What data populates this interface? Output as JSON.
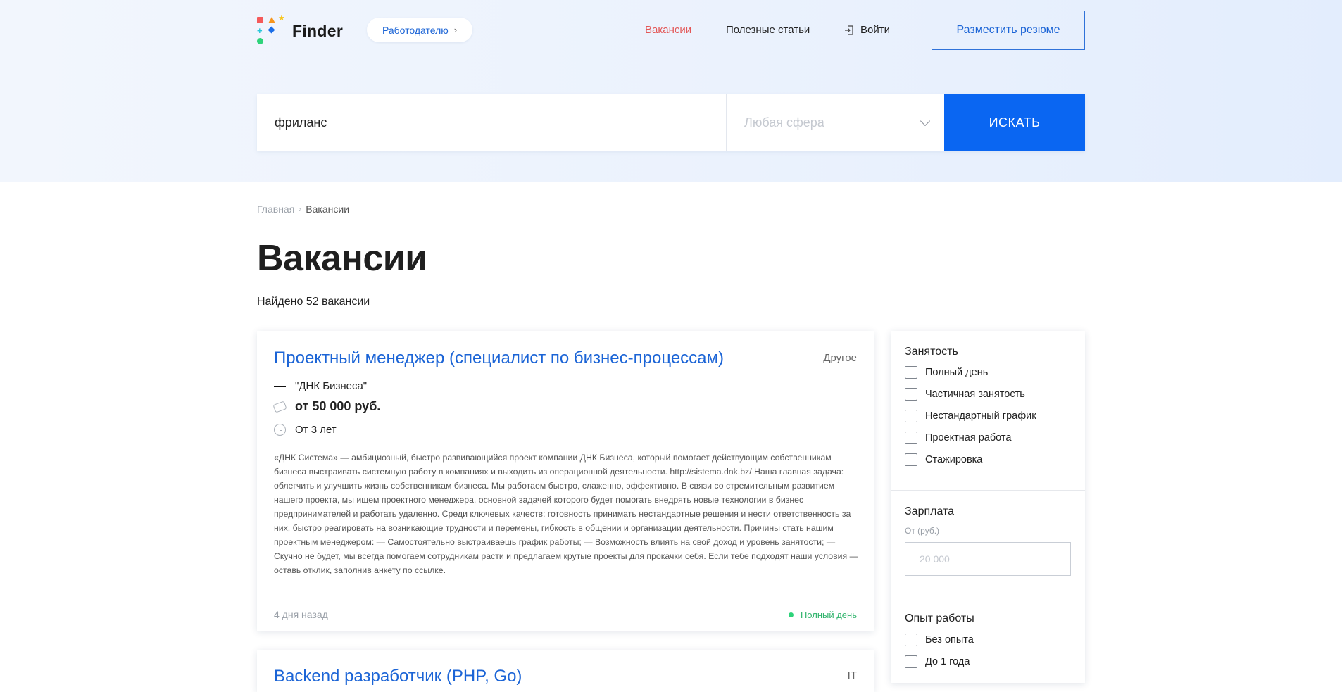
{
  "header": {
    "logo_text": "Finder",
    "employer_label": "Работодателю",
    "nav": {
      "vacancies": "Вакансии",
      "articles": "Полезные статьи",
      "login": "Войти"
    },
    "resume_button": "Разместить резюме"
  },
  "search": {
    "query_value": "фриланс",
    "sphere_placeholder": "Любая сфера",
    "button": "ИСКАТЬ"
  },
  "breadcrumb": {
    "home": "Главная",
    "current": "Вакансии"
  },
  "page": {
    "title": "Вакансии",
    "found": "Найдено 52 вакансии"
  },
  "vacancies": [
    {
      "title": "Проектный менеджер (специалист по бизнес-процессам)",
      "category": "Другое",
      "company": "\"ДНК Бизнеса\"",
      "salary": "от 50 000 руб.",
      "experience": "От 3 лет",
      "description": "«ДНК Система» — амбициозный, быстро развивающийся проект компании ДНК Бизнеса, который помогает действующим собственникам бизнеса выстраивать системную работу в компаниях и выходить из операционной деятельности. http://sistema.dnk.bz/ Наша главная задача: облегчить и улучшить жизнь собственникам бизнеса. Мы работаем быстро, слаженно, эффективно. В связи со стремительным развитием нашего проекта, мы ищем проектного менеджера, основной задачей которого будет помогать внедрять новые технологии в бизнес предпринимателей и работать удаленно. Среди ключевых качеств: готовность принимать нестандартные решения и нести ответственность за них, быстро реагировать на возникающие трудности и перемены, гибкость в общении и организации деятельности. Причины стать нашим проектным менеджером: — Самостоятельно выстраиваешь график работы; — Возможность влиять на свой доход и уровень занятости; — Скучно не будет, мы всегда помогаем сотрудникам расти и предлагаем крутые проекты для прокачки себя. Если тебе подходят наши условия — оставь отклик, заполнив анкету по ссылке.",
      "posted": "4 дня назад",
      "employment": "Полный день"
    },
    {
      "title": "Backend разработчик (PHP, Go)",
      "category": "IT"
    }
  ],
  "filters": {
    "employment": {
      "title": "Занятость",
      "options": [
        "Полный день",
        "Частичная занятость",
        "Нестандартный график",
        "Проектная работа",
        "Стажировка"
      ]
    },
    "salary": {
      "title": "Зарплата",
      "from_label": "От (руб.)",
      "placeholder": "20 000"
    },
    "experience": {
      "title": "Опыт работы",
      "options": [
        "Без опыта",
        "До 1 года"
      ]
    }
  },
  "colors": {
    "accent": "#0a66f2",
    "link": "#1b64d6",
    "nav_active": "#e35757",
    "success": "#2fb36b"
  }
}
